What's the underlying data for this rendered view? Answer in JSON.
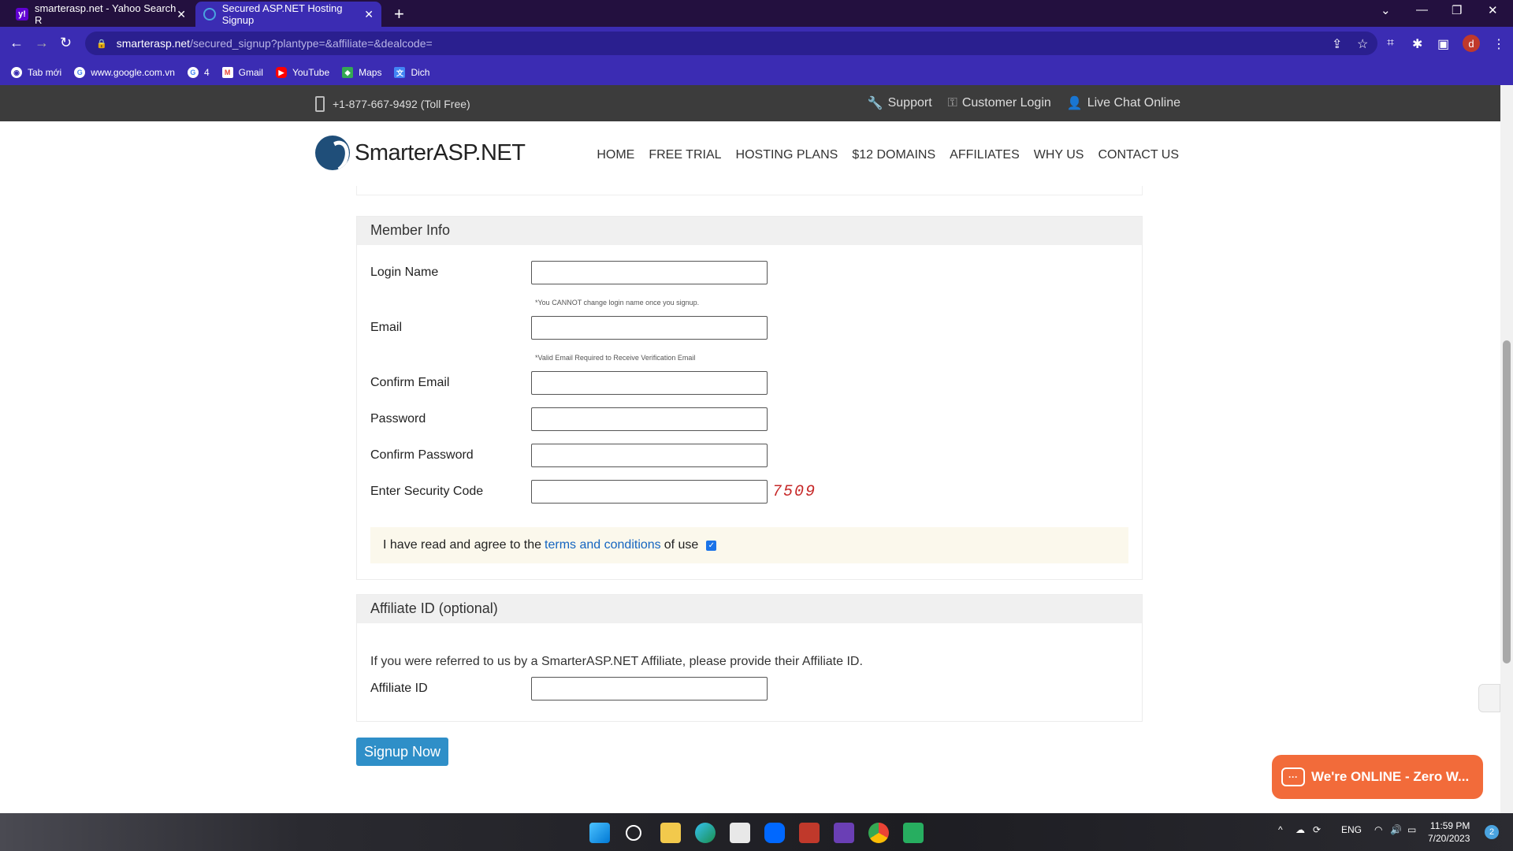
{
  "browser": {
    "tabs": [
      {
        "title": "smarterasp.net - Yahoo Search R",
        "active": false
      },
      {
        "title": "Secured ASP.NET Hosting Signup",
        "active": true
      }
    ],
    "url_host": "smarterasp.net",
    "url_path": "/secured_signup?plantype=&affiliate=&dealcode=",
    "profile_initial": "d",
    "bookmarks": [
      "Tab mới",
      "www.google.com.vn",
      "4",
      "Gmail",
      "YouTube",
      "Maps",
      "Dich"
    ]
  },
  "topbar": {
    "phone": "+1-877-667-9492 (Toll Free)",
    "support": "Support",
    "customer_login": "Customer Login",
    "live_chat": "Live Chat Online"
  },
  "header": {
    "logo_text": "SmarterASP.NET",
    "nav": [
      "HOME",
      "FREE TRIAL",
      "HOSTING PLANS",
      "$12 DOMAINS",
      "AFFILIATES",
      "WHY US",
      "CONTACT US"
    ]
  },
  "member_info": {
    "title": "Member Info",
    "login_name_label": "Login Name",
    "login_hint": "*You CANNOT change login name once you signup.",
    "email_label": "Email",
    "email_hint": "*Valid Email Required to Receive Verification Email",
    "confirm_email_label": "Confirm Email",
    "password_label": "Password",
    "confirm_password_label": "Confirm Password",
    "security_code_label": "Enter Security Code",
    "captcha": "7509",
    "terms_prefix": "I have read and agree to the",
    "terms_link": "terms and conditions",
    "terms_suffix": "of use",
    "terms_checked": true
  },
  "affiliate": {
    "title": "Affiliate ID (optional)",
    "text": "If you were referred to us by a SmarterASP.NET Affiliate, please provide their Affiliate ID.",
    "label": "Affiliate ID"
  },
  "signup_button": "Signup Now",
  "chat_widget": "We're ONLINE - Zero W...",
  "taskbar": {
    "language": "ENG",
    "time": "11:59 PM",
    "date": "7/20/2023",
    "notifications": "2",
    "zalo_badge": "2"
  },
  "colors": {
    "browser_bg": "#3b2cb3",
    "topbar_bg": "#3c3c3c",
    "link": "#1565c0",
    "signup_button": "#2f8fc8",
    "chat_widget": "#f26b3a"
  }
}
